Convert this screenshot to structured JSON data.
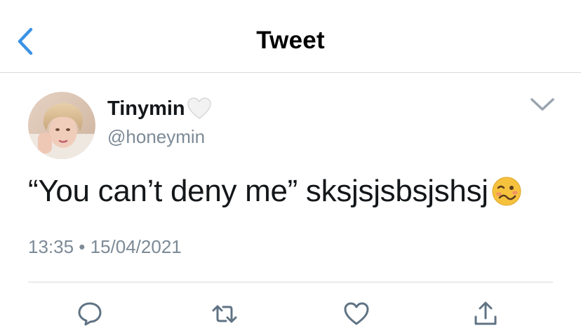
{
  "header": {
    "title": "Tweet",
    "back_icon": "chevron-left-icon"
  },
  "tweet": {
    "author": {
      "display_name": "Tinymin",
      "name_emoji": "white-heart-emoji",
      "handle": "@honeymin"
    },
    "text": "“You can’t deny me” sksjsjsbsjshsj",
    "text_emoji": "woozy-face-emoji",
    "timestamp": "13:35 • 15/04/2021",
    "more_icon": "chevron-down-icon"
  },
  "actions": [
    {
      "icon": "reply-icon"
    },
    {
      "icon": "retweet-icon"
    },
    {
      "icon": "like-icon"
    },
    {
      "icon": "share-icon"
    }
  ],
  "colors": {
    "accent": "#1da1f2",
    "text": "#14171a",
    "secondary": "#7c8a96",
    "divider": "#d9d9d9",
    "icon": "#5f7384"
  }
}
